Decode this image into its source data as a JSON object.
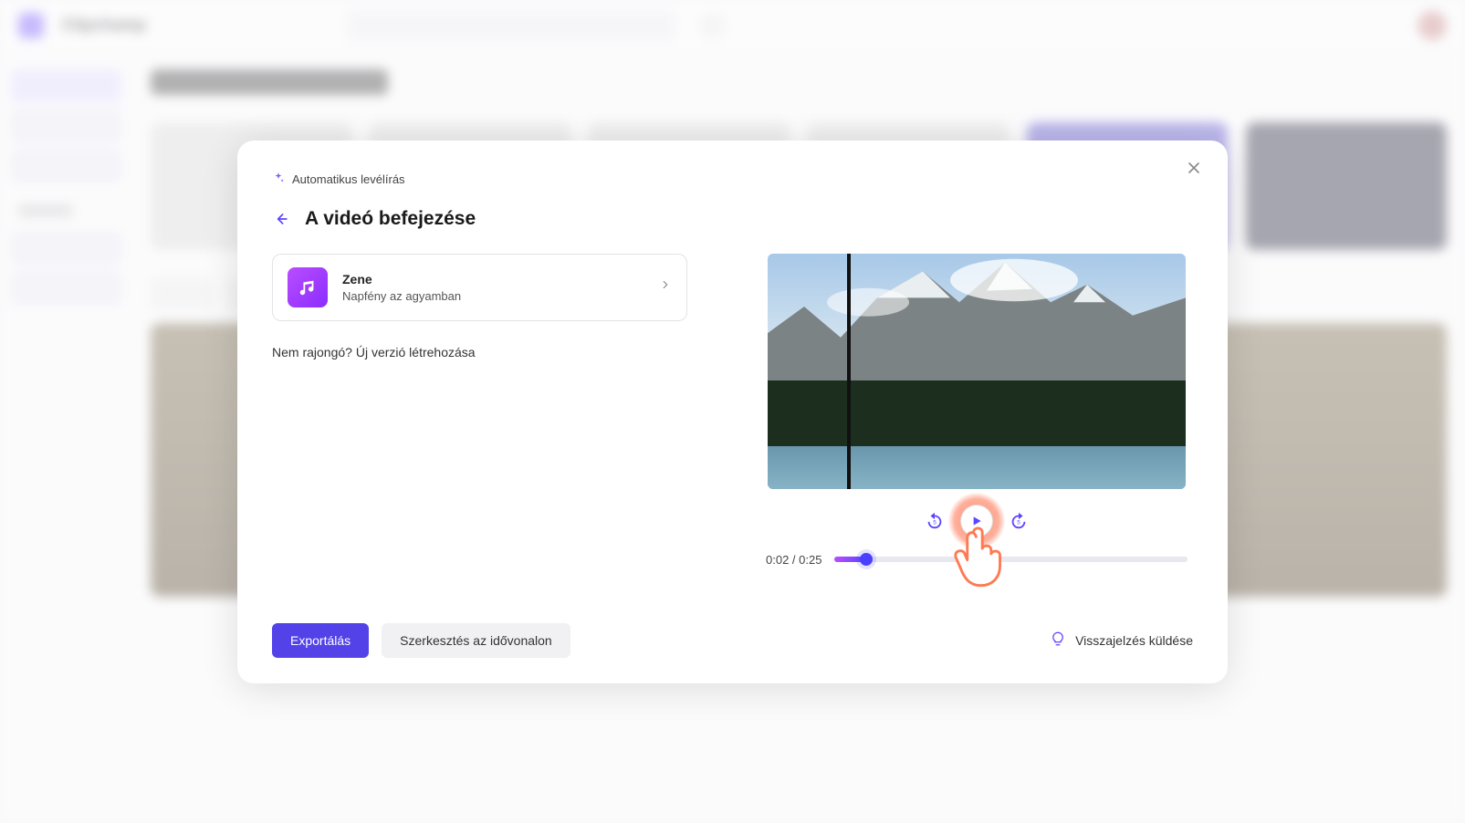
{
  "modal": {
    "breadcrumb": "Automatikus levélírás",
    "title": "A videó befejezése",
    "music": {
      "heading": "Zene",
      "track": "Napfény az agyamban"
    },
    "regenerate": "Nem rajongó? Új verzió létrehozása",
    "time": {
      "label": "0:02 / 0:25",
      "current_seconds": 2,
      "total_seconds": 25,
      "progress_pct": 8
    },
    "buttons": {
      "export": "Exportálás",
      "edit_timeline": "Szerkesztés az idővonalon",
      "feedback": "Visszajelzés küldése"
    }
  },
  "colors": {
    "accent": "#5342e8",
    "music_gradient_a": "#b94dff",
    "music_gradient_b": "#8b2dff"
  }
}
